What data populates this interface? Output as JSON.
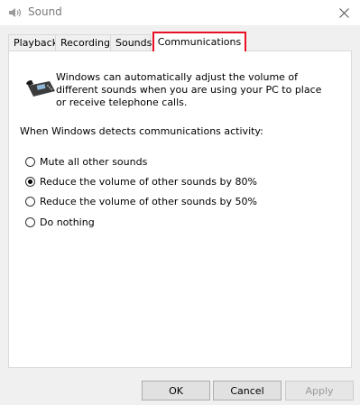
{
  "window": {
    "title": "Sound"
  },
  "tabs": [
    {
      "label": "Playback",
      "active": false
    },
    {
      "label": "Recording",
      "active": false
    },
    {
      "label": "Sounds",
      "active": false
    },
    {
      "label": "Communications",
      "active": true
    }
  ],
  "communications": {
    "intro_text": "Windows can automatically adjust the volume of different sounds when you are using your PC to place or receive telephone calls.",
    "detect_label": "When Windows detects communications activity:",
    "options": [
      {
        "label": "Mute all other sounds",
        "checked": false
      },
      {
        "label": "Reduce the volume of other sounds by 80%",
        "checked": true
      },
      {
        "label": "Reduce the volume of other sounds by 50%",
        "checked": false
      },
      {
        "label": "Do nothing",
        "checked": false
      }
    ]
  },
  "buttons": {
    "ok": "OK",
    "cancel": "Cancel",
    "apply": "Apply"
  },
  "colors": {
    "active_tab_highlight": "#e81123"
  }
}
